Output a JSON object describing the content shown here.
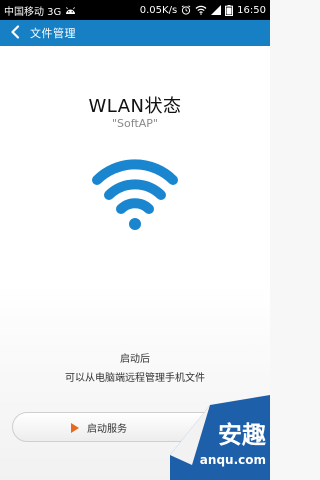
{
  "status_bar": {
    "carrier": "中国移动 3G",
    "speed": "0.05K/s",
    "time": "16:50",
    "icons": [
      "android-icon",
      "alarm-icon",
      "wifi-icon",
      "signal-icon",
      "battery-icon"
    ]
  },
  "header": {
    "back_icon": "chevron-left-icon",
    "title": "文件管理"
  },
  "main": {
    "title": "WLAN状态",
    "mode": "\"SoftAP\"",
    "wifi_icon": "wifi-icon",
    "hint_line1": "启动后",
    "hint_line2": "可以从电脑端远程管理手机文件"
  },
  "start_button": {
    "icon": "play-icon",
    "label": "启动服务"
  },
  "watermark": {
    "brand": "安趣",
    "site": "anqu.com"
  },
  "colors": {
    "header_bg": "#1780c5",
    "wifi_blue": "#1a86d0",
    "play_orange": "#e8681c"
  }
}
